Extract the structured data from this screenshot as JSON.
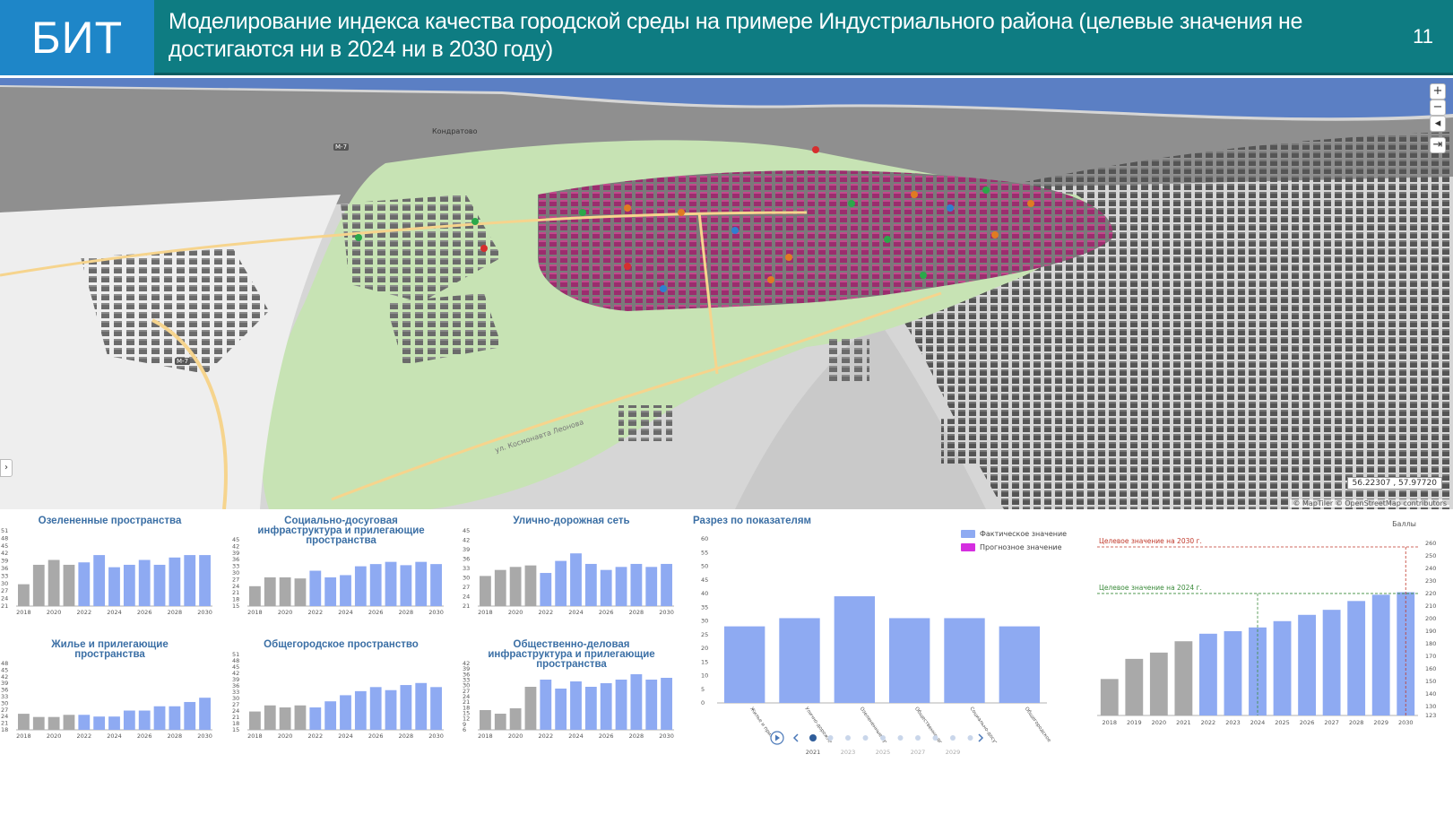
{
  "header": {
    "logo": "БИТ",
    "title": "Моделирование  индекса качества городской среды на примере Индустриального района (целевые значения не достигаются ни в 2024 ни в 2030 году)",
    "page_number": "11"
  },
  "map": {
    "labels": [
      "Кондратово",
      "M-7",
      "M-7",
      "ул. Космонавта Леонова"
    ],
    "coords": "56.22307 , 57.97720",
    "attribution": "© MapTiler © OpenStreetMap contributors",
    "controls": {
      "zoom_in": "+",
      "zoom_out": "−",
      "compass": "◂",
      "export": "⇥",
      "side_toggle": "›"
    }
  },
  "colors": {
    "header_bg": "#0e7c82",
    "logo_bg": "#1e86c8",
    "fact": "#8eaaf2",
    "history": "#a9a9a9",
    "forecast": "#d52ee0",
    "title": "#3b6fa5"
  },
  "mini_charts": [
    {
      "title": "Озелененные пространства",
      "ticks": [
        "51",
        "48",
        "45",
        "42",
        "39",
        "36",
        "33",
        "30",
        "27",
        "24",
        "21"
      ],
      "years": [
        "2018",
        "2020",
        "2022",
        "2024",
        "2026",
        "2028",
        "2030"
      ]
    },
    {
      "title": "Социально-досуговая инфраструктура и прилегающие пространства",
      "ticks": [
        "45",
        "42",
        "39",
        "36",
        "33",
        "30",
        "27",
        "24",
        "21",
        "18",
        "15"
      ],
      "years": [
        "2018",
        "2020",
        "2022",
        "2024",
        "2026",
        "2028",
        "2030"
      ]
    },
    {
      "title": "Улично-дорожная сеть",
      "ticks": [
        "45",
        "42",
        "39",
        "36",
        "33",
        "30",
        "27",
        "24",
        "21"
      ],
      "years": [
        "2018",
        "2020",
        "2022",
        "2024",
        "2026",
        "2028",
        "2030"
      ]
    },
    {
      "title": "Жилье и прилегающие пространства",
      "ticks": [
        "48",
        "45",
        "42",
        "39",
        "36",
        "33",
        "30",
        "27",
        "24",
        "21",
        "18"
      ],
      "years": [
        "2018",
        "2020",
        "2022",
        "2024",
        "2026",
        "2028",
        "2030"
      ]
    },
    {
      "title": "Общегородское пространство",
      "ticks": [
        "51",
        "48",
        "45",
        "42",
        "39",
        "36",
        "33",
        "30",
        "27",
        "24",
        "21",
        "18",
        "15"
      ],
      "years": [
        "2018",
        "2020",
        "2022",
        "2024",
        "2026",
        "2028",
        "2030"
      ]
    },
    {
      "title": "Общественно-деловая инфраструктура и прилегающие пространства",
      "ticks": [
        "42",
        "39",
        "36",
        "33",
        "30",
        "27",
        "24",
        "21",
        "18",
        "15",
        "12",
        "9",
        "6"
      ],
      "years": [
        "2018",
        "2020",
        "2022",
        "2024",
        "2026",
        "2028",
        "2030"
      ]
    }
  ],
  "breakdown": {
    "title": "Разрез по показателям",
    "legend": [
      "Фактическое значение",
      "Прогнозное значение"
    ],
    "yticks": [
      "60",
      "55",
      "50",
      "45",
      "40",
      "35",
      "30",
      "25",
      "20",
      "15",
      "10",
      "5",
      "0"
    ],
    "categories": [
      "Жилье и прилегающие пространства",
      "Улично-дорожная сеть",
      "Озелененные пространства",
      "Общественно-деловая инфраструктура и прилегающие пространства",
      "Социально-досуговая инфраструктура и прилегающие пространства",
      "Общегородское пространство"
    ],
    "player_years": [
      "2021",
      "2023",
      "2025",
      "2027",
      "2029"
    ]
  },
  "total": {
    "unit_label": "Баллы",
    "target_2030": "Целевое значение на 2030 г.",
    "target_2024": "Целевое значение на 2024 г.",
    "yticks": [
      "260",
      "250",
      "240",
      "230",
      "220",
      "210",
      "200",
      "190",
      "180",
      "170",
      "160",
      "150",
      "140",
      "130",
      "123"
    ],
    "years": [
      "2018",
      "2019",
      "2020",
      "2021",
      "2022",
      "2023",
      "2024",
      "2025",
      "2026",
      "2027",
      "2028",
      "2029",
      "2030"
    ]
  },
  "chart_data": [
    {
      "type": "bar",
      "title": "Озелененные пространства",
      "categories": [
        "2018",
        "2019",
        "2020",
        "2021",
        "2022",
        "2023",
        "2024",
        "2025",
        "2026",
        "2027",
        "2028",
        "2029",
        "2030"
      ],
      "values": [
        29,
        37,
        39,
        37,
        38,
        41,
        36,
        37,
        39,
        37,
        40,
        41,
        41
      ],
      "ylim": [
        20,
        51
      ]
    },
    {
      "type": "bar",
      "title": "Социально-досуговая инфраструктура и прилегающие пространства",
      "categories": [
        "2018",
        "2019",
        "2020",
        "2021",
        "2022",
        "2023",
        "2024",
        "2025",
        "2026",
        "2027",
        "2028",
        "2029",
        "2030"
      ],
      "values": [
        24,
        28,
        28,
        27.5,
        31,
        28,
        29,
        33,
        34,
        35,
        33.5,
        35,
        34
      ],
      "ylim": [
        15,
        45
      ]
    },
    {
      "type": "bar",
      "title": "Улично-дорожная сеть",
      "categories": [
        "2018",
        "2019",
        "2020",
        "2021",
        "2022",
        "2023",
        "2024",
        "2025",
        "2026",
        "2027",
        "2028",
        "2029",
        "2030"
      ],
      "values": [
        30,
        32,
        33,
        33.5,
        31,
        35,
        37.5,
        34,
        32,
        33,
        34,
        33,
        34
      ],
      "ylim": [
        20,
        45
      ]
    },
    {
      "type": "bar",
      "title": "Жилье и прилегающие пространства",
      "categories": [
        "2018",
        "2019",
        "2020",
        "2021",
        "2022",
        "2023",
        "2024",
        "2025",
        "2026",
        "2027",
        "2028",
        "2029",
        "2030"
      ],
      "values": [
        24.5,
        23,
        23,
        24,
        24,
        23.2,
        23.2,
        26,
        26,
        28,
        28,
        30,
        32
      ],
      "ylim": [
        17,
        48
      ]
    },
    {
      "type": "bar",
      "title": "Общегородское пространство",
      "categories": [
        "2018",
        "2019",
        "2020",
        "2021",
        "2022",
        "2023",
        "2024",
        "2025",
        "2026",
        "2027",
        "2028",
        "2029",
        "2030"
      ],
      "values": [
        23,
        26,
        25,
        26,
        25,
        28,
        31,
        33,
        35,
        33.5,
        36,
        37,
        35
      ],
      "ylim": [
        14,
        51
      ]
    },
    {
      "type": "bar",
      "title": "Общественно-деловая инфраструктура и прилегающие пространства",
      "categories": [
        "2018",
        "2019",
        "2020",
        "2021",
        "2022",
        "2023",
        "2024",
        "2025",
        "2026",
        "2027",
        "2028",
        "2029",
        "2030"
      ],
      "values": [
        16,
        14,
        17,
        29,
        33,
        28,
        32,
        29,
        31,
        33,
        36,
        33,
        34
      ],
      "ylim": [
        5,
        42
      ]
    },
    {
      "type": "bar",
      "title": "Разрез по показателям",
      "categories": [
        "Жилье и прилегающие пространства",
        "Улично-дорожная сеть",
        "Озелененные пространства",
        "Общественно-деловая инфраструктура и прилегающие пространства",
        "Социально-досуговая инфраструктура и прилегающие пространства",
        "Общегородское пространство"
      ],
      "values": [
        28,
        31,
        39,
        31,
        31,
        28
      ],
      "ylim": [
        0,
        60
      ],
      "legend": [
        "Фактическое значение",
        "Прогнозное значение"
      ]
    },
    {
      "type": "bar",
      "title": "Баллы",
      "categories": [
        "2018",
        "2019",
        "2020",
        "2021",
        "2022",
        "2023",
        "2024",
        "2025",
        "2026",
        "2027",
        "2028",
        "2029",
        "2030"
      ],
      "values": [
        152,
        168,
        173,
        182,
        188,
        190,
        193,
        198,
        203,
        207,
        214,
        219,
        221
      ],
      "ylim": [
        123,
        262
      ],
      "targets": {
        "2024": 220,
        "2030": 257
      }
    }
  ]
}
